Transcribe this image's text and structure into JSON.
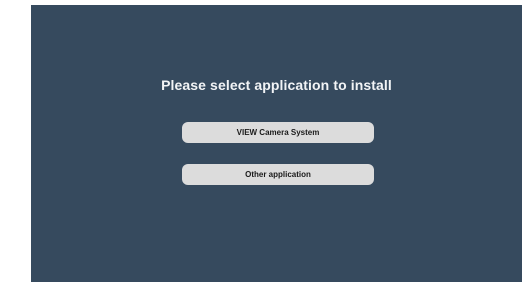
{
  "dialog": {
    "title": "Please select application to install",
    "options": [
      {
        "label": "VIEW Camera System"
      },
      {
        "label": "Other application"
      }
    ]
  },
  "colors": {
    "background": "#364a5e",
    "button": "#dcdcdc",
    "title_text": "#f2f4f6",
    "button_text": "#1a1a1a"
  }
}
